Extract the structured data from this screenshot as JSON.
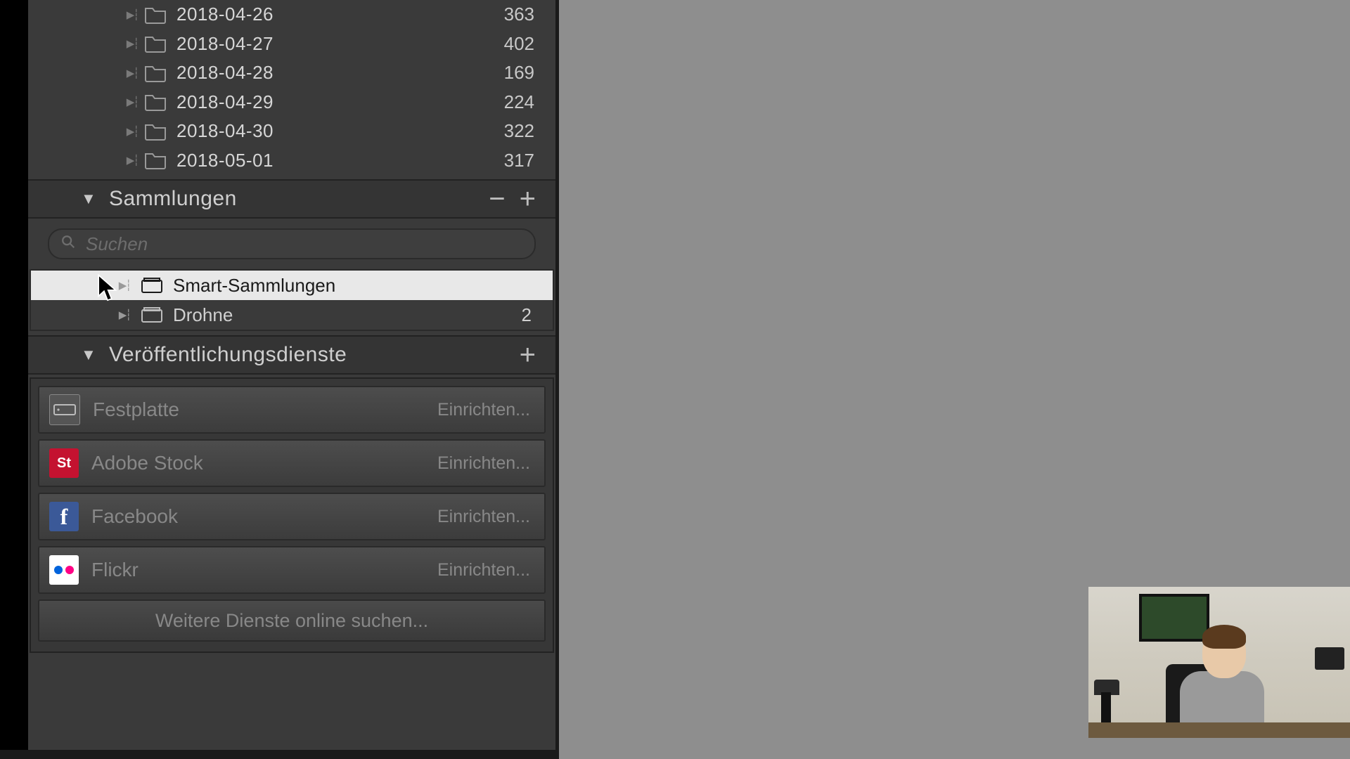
{
  "folders": [
    {
      "name": "2018-04-26",
      "count": "363"
    },
    {
      "name": "2018-04-27",
      "count": "402"
    },
    {
      "name": "2018-04-28",
      "count": "169"
    },
    {
      "name": "2018-04-29",
      "count": "224"
    },
    {
      "name": "2018-04-30",
      "count": "322"
    },
    {
      "name": "2018-05-01",
      "count": "317"
    }
  ],
  "collections": {
    "title": "Sammlungen",
    "search_placeholder": "Suchen",
    "items": [
      {
        "name": "Smart-Sammlungen",
        "count": "",
        "selected": true
      },
      {
        "name": "Drohne",
        "count": "2",
        "selected": false
      }
    ]
  },
  "publish": {
    "title": "Veröffentlichungsdienste",
    "setup_label": "Einrichten...",
    "services": [
      {
        "name": "Festplatte",
        "icon": "hd"
      },
      {
        "name": "Adobe Stock",
        "icon": "st"
      },
      {
        "name": "Facebook",
        "icon": "fb"
      },
      {
        "name": "Flickr",
        "icon": "fl"
      }
    ],
    "more_label": "Weitere Dienste online suchen..."
  },
  "glyphs": {
    "minus": "−",
    "plus": "+"
  }
}
